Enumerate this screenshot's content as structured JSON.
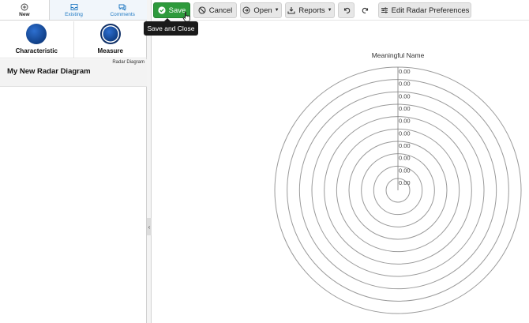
{
  "sidebar": {
    "tabs": [
      {
        "label": "New",
        "icon": "plus-circle-icon",
        "active": true
      },
      {
        "label": "Existing",
        "icon": "inbox-icon",
        "active": false
      },
      {
        "label": "Comments",
        "icon": "comments-icon",
        "active": false
      }
    ],
    "shapes": [
      {
        "label": "Characteristic",
        "icon": "filled-circle-icon"
      },
      {
        "label": "Measure",
        "icon": "ringed-circle-icon"
      }
    ],
    "diagram": {
      "type": "Radar Diagram",
      "name": "My New Radar Diagram"
    }
  },
  "toolbar": {
    "save_label": "Save",
    "cancel_label": "Cancel",
    "open_label": "Open",
    "reports_label": "Reports",
    "preferences_label": "Edit Radar Preferences",
    "save_tooltip": "Save and Close"
  },
  "colors": {
    "save_green": "#2e9a3c",
    "shape_blue": "#1a4f9c",
    "ring_gray": "#9a9a9a"
  },
  "chart_data": {
    "type": "radar",
    "title": "Meaningful Name",
    "rings": 10,
    "ring_labels": [
      "0.00",
      "0.00",
      "0.00",
      "0.00",
      "0.00",
      "0.00",
      "0.00",
      "0.00",
      "0.00",
      "0.00"
    ]
  }
}
